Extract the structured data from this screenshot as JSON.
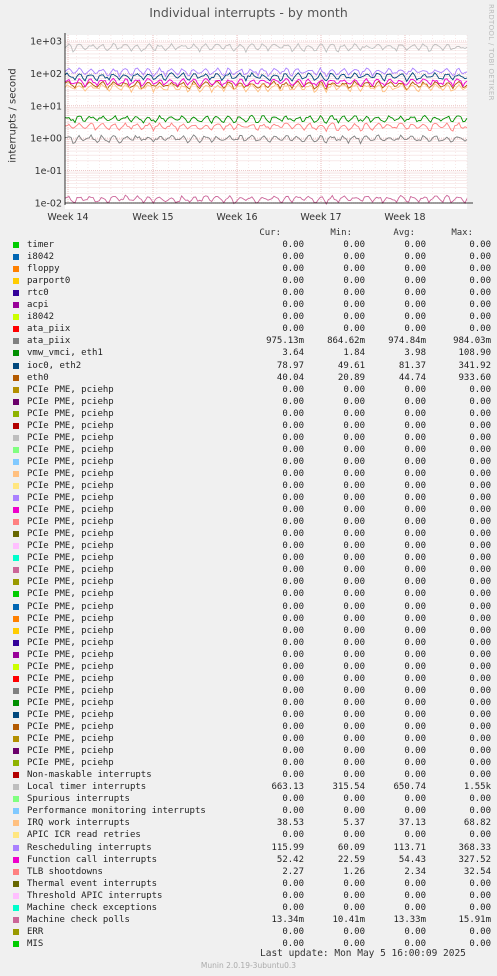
{
  "chart_data": {
    "type": "line",
    "title": "Individual interrupts - by month",
    "ylabel": "interrupts / second",
    "yscale": "log",
    "ylim": [
      0.01,
      1000
    ],
    "yticks": [
      "1e-02",
      "1e-01",
      "1e+00",
      "1e+01",
      "1e+02",
      "1e+03"
    ],
    "xticks": [
      "Week 14",
      "Week 15",
      "Week 16",
      "Week 17",
      "Week 18"
    ],
    "side_label": "RRDTOOL / TOBI OETIKER",
    "columns": [
      "Cur:",
      "Min:",
      "Avg:",
      "Max:"
    ],
    "series": [
      {
        "name": "timer",
        "color": "#00cc00",
        "cur": "0.00",
        "min": "0.00",
        "avg": "0.00",
        "max": "0.00"
      },
      {
        "name": "i8042",
        "color": "#0066b3",
        "cur": "0.00",
        "min": "0.00",
        "avg": "0.00",
        "max": "0.00"
      },
      {
        "name": "floppy",
        "color": "#ff8000",
        "cur": "0.00",
        "min": "0.00",
        "avg": "0.00",
        "max": "0.00"
      },
      {
        "name": "parport0",
        "color": "#ffcc00",
        "cur": "0.00",
        "min": "0.00",
        "avg": "0.00",
        "max": "0.00"
      },
      {
        "name": "rtc0",
        "color": "#330099",
        "cur": "0.00",
        "min": "0.00",
        "avg": "0.00",
        "max": "0.00"
      },
      {
        "name": "acpi",
        "color": "#990099",
        "cur": "0.00",
        "min": "0.00",
        "avg": "0.00",
        "max": "0.00"
      },
      {
        "name": "i8042",
        "color": "#ccff00",
        "cur": "0.00",
        "min": "0.00",
        "avg": "0.00",
        "max": "0.00"
      },
      {
        "name": "ata_piix",
        "color": "#ff0000",
        "cur": "0.00",
        "min": "0.00",
        "avg": "0.00",
        "max": "0.00"
      },
      {
        "name": "ata_piix",
        "color": "#808080",
        "cur": "975.13m",
        "min": "864.62m",
        "avg": "974.84m",
        "max": "984.03m"
      },
      {
        "name": "vmw_vmci, eth1",
        "color": "#008f00",
        "cur": "3.64",
        "min": "1.84",
        "avg": "3.98",
        "max": "108.90"
      },
      {
        "name": "ioc0, eth2",
        "color": "#00487d",
        "cur": "78.97",
        "min": "49.61",
        "avg": "81.37",
        "max": "341.92"
      },
      {
        "name": "eth0",
        "color": "#b35a00",
        "cur": "40.04",
        "min": "20.89",
        "avg": "44.74",
        "max": "933.60"
      },
      {
        "name": "PCIe PME, pciehp",
        "color": "#b38f00",
        "cur": "0.00",
        "min": "0.00",
        "avg": "0.00",
        "max": "0.00"
      },
      {
        "name": "PCIe PME, pciehp",
        "color": "#6b006b",
        "cur": "0.00",
        "min": "0.00",
        "avg": "0.00",
        "max": "0.00"
      },
      {
        "name": "PCIe PME, pciehp",
        "color": "#8fb300",
        "cur": "0.00",
        "min": "0.00",
        "avg": "0.00",
        "max": "0.00"
      },
      {
        "name": "PCIe PME, pciehp",
        "color": "#b30000",
        "cur": "0.00",
        "min": "0.00",
        "avg": "0.00",
        "max": "0.00"
      },
      {
        "name": "PCIe PME, pciehp",
        "color": "#bebebe",
        "cur": "0.00",
        "min": "0.00",
        "avg": "0.00",
        "max": "0.00"
      },
      {
        "name": "PCIe PME, pciehp",
        "color": "#80ff80",
        "cur": "0.00",
        "min": "0.00",
        "avg": "0.00",
        "max": "0.00"
      },
      {
        "name": "PCIe PME, pciehp",
        "color": "#80c9ff",
        "cur": "0.00",
        "min": "0.00",
        "avg": "0.00",
        "max": "0.00"
      },
      {
        "name": "PCIe PME, pciehp",
        "color": "#ffc080",
        "cur": "0.00",
        "min": "0.00",
        "avg": "0.00",
        "max": "0.00"
      },
      {
        "name": "PCIe PME, pciehp",
        "color": "#ffe680",
        "cur": "0.00",
        "min": "0.00",
        "avg": "0.00",
        "max": "0.00"
      },
      {
        "name": "PCIe PME, pciehp",
        "color": "#aa80ff",
        "cur": "0.00",
        "min": "0.00",
        "avg": "0.00",
        "max": "0.00"
      },
      {
        "name": "PCIe PME, pciehp",
        "color": "#ee00cc",
        "cur": "0.00",
        "min": "0.00",
        "avg": "0.00",
        "max": "0.00"
      },
      {
        "name": "PCIe PME, pciehp",
        "color": "#ff8080",
        "cur": "0.00",
        "min": "0.00",
        "avg": "0.00",
        "max": "0.00"
      },
      {
        "name": "PCIe PME, pciehp",
        "color": "#666600",
        "cur": "0.00",
        "min": "0.00",
        "avg": "0.00",
        "max": "0.00"
      },
      {
        "name": "PCIe PME, pciehp",
        "color": "#ffbfff",
        "cur": "0.00",
        "min": "0.00",
        "avg": "0.00",
        "max": "0.00"
      },
      {
        "name": "PCIe PME, pciehp",
        "color": "#00ffcc",
        "cur": "0.00",
        "min": "0.00",
        "avg": "0.00",
        "max": "0.00"
      },
      {
        "name": "PCIe PME, pciehp",
        "color": "#cc6699",
        "cur": "0.00",
        "min": "0.00",
        "avg": "0.00",
        "max": "0.00"
      },
      {
        "name": "PCIe PME, pciehp",
        "color": "#999900",
        "cur": "0.00",
        "min": "0.00",
        "avg": "0.00",
        "max": "0.00"
      },
      {
        "name": "PCIe PME, pciehp",
        "color": "#00cc00",
        "cur": "0.00",
        "min": "0.00",
        "avg": "0.00",
        "max": "0.00"
      },
      {
        "name": "PCIe PME, pciehp",
        "color": "#0066b3",
        "cur": "0.00",
        "min": "0.00",
        "avg": "0.00",
        "max": "0.00"
      },
      {
        "name": "PCIe PME, pciehp",
        "color": "#ff8000",
        "cur": "0.00",
        "min": "0.00",
        "avg": "0.00",
        "max": "0.00"
      },
      {
        "name": "PCIe PME, pciehp",
        "color": "#ffcc00",
        "cur": "0.00",
        "min": "0.00",
        "avg": "0.00",
        "max": "0.00"
      },
      {
        "name": "PCIe PME, pciehp",
        "color": "#330099",
        "cur": "0.00",
        "min": "0.00",
        "avg": "0.00",
        "max": "0.00"
      },
      {
        "name": "PCIe PME, pciehp",
        "color": "#990099",
        "cur": "0.00",
        "min": "0.00",
        "avg": "0.00",
        "max": "0.00"
      },
      {
        "name": "PCIe PME, pciehp",
        "color": "#ccff00",
        "cur": "0.00",
        "min": "0.00",
        "avg": "0.00",
        "max": "0.00"
      },
      {
        "name": "PCIe PME, pciehp",
        "color": "#ff0000",
        "cur": "0.00",
        "min": "0.00",
        "avg": "0.00",
        "max": "0.00"
      },
      {
        "name": "PCIe PME, pciehp",
        "color": "#808080",
        "cur": "0.00",
        "min": "0.00",
        "avg": "0.00",
        "max": "0.00"
      },
      {
        "name": "PCIe PME, pciehp",
        "color": "#008f00",
        "cur": "0.00",
        "min": "0.00",
        "avg": "0.00",
        "max": "0.00"
      },
      {
        "name": "PCIe PME, pciehp",
        "color": "#00487d",
        "cur": "0.00",
        "min": "0.00",
        "avg": "0.00",
        "max": "0.00"
      },
      {
        "name": "PCIe PME, pciehp",
        "color": "#b35a00",
        "cur": "0.00",
        "min": "0.00",
        "avg": "0.00",
        "max": "0.00"
      },
      {
        "name": "PCIe PME, pciehp",
        "color": "#b38f00",
        "cur": "0.00",
        "min": "0.00",
        "avg": "0.00",
        "max": "0.00"
      },
      {
        "name": "PCIe PME, pciehp",
        "color": "#6b006b",
        "cur": "0.00",
        "min": "0.00",
        "avg": "0.00",
        "max": "0.00"
      },
      {
        "name": "PCIe PME, pciehp",
        "color": "#8fb300",
        "cur": "0.00",
        "min": "0.00",
        "avg": "0.00",
        "max": "0.00"
      },
      {
        "name": "Non-maskable interrupts",
        "color": "#b30000",
        "cur": "0.00",
        "min": "0.00",
        "avg": "0.00",
        "max": "0.00"
      },
      {
        "name": "Local timer interrupts",
        "color": "#bebebe",
        "cur": "663.13",
        "min": "315.54",
        "avg": "650.74",
        "max": "1.55k"
      },
      {
        "name": "Spurious interrupts",
        "color": "#80ff80",
        "cur": "0.00",
        "min": "0.00",
        "avg": "0.00",
        "max": "0.00"
      },
      {
        "name": "Performance monitoring interrupts",
        "color": "#80c9ff",
        "cur": "0.00",
        "min": "0.00",
        "avg": "0.00",
        "max": "0.00"
      },
      {
        "name": "IRQ work interrupts",
        "color": "#ffc080",
        "cur": "38.53",
        "min": "5.37",
        "avg": "37.13",
        "max": "68.82"
      },
      {
        "name": "APIC ICR read retries",
        "color": "#ffe680",
        "cur": "0.00",
        "min": "0.00",
        "avg": "0.00",
        "max": "0.00"
      },
      {
        "name": "Rescheduling interrupts",
        "color": "#aa80ff",
        "cur": "115.99",
        "min": "60.09",
        "avg": "113.71",
        "max": "368.33"
      },
      {
        "name": "Function call interrupts",
        "color": "#ee00cc",
        "cur": "52.42",
        "min": "22.59",
        "avg": "54.43",
        "max": "327.52"
      },
      {
        "name": "TLB shootdowns",
        "color": "#ff8080",
        "cur": "2.27",
        "min": "1.26",
        "avg": "2.34",
        "max": "32.54"
      },
      {
        "name": "Thermal event interrupts",
        "color": "#666600",
        "cur": "0.00",
        "min": "0.00",
        "avg": "0.00",
        "max": "0.00"
      },
      {
        "name": "Threshold APIC interrupts",
        "color": "#ffbfff",
        "cur": "0.00",
        "min": "0.00",
        "avg": "0.00",
        "max": "0.00"
      },
      {
        "name": "Machine check exceptions",
        "color": "#00ffcc",
        "cur": "0.00",
        "min": "0.00",
        "avg": "0.00",
        "max": "0.00"
      },
      {
        "name": "Machine check polls",
        "color": "#cc6699",
        "cur": "13.34m",
        "min": "10.41m",
        "avg": "13.33m",
        "max": "15.91m"
      },
      {
        "name": "ERR",
        "color": "#999900",
        "cur": "0.00",
        "min": "0.00",
        "avg": "0.00",
        "max": "0.00"
      },
      {
        "name": "MIS",
        "color": "#00cc00",
        "cur": "0.00",
        "min": "0.00",
        "avg": "0.00",
        "max": "0.00"
      }
    ]
  },
  "footer": {
    "last_update": "Last update:  Mon May  5 16:00:09 2025",
    "munin": "Munin 2.0.19-3ubuntu0.3"
  }
}
